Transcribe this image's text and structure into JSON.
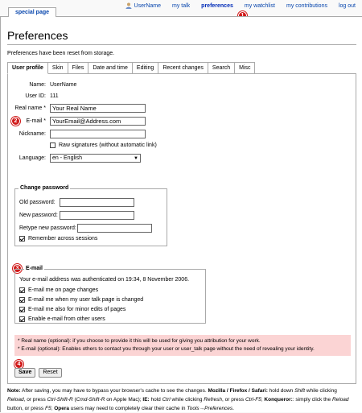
{
  "personal_bar": {
    "username": "UserName",
    "items": [
      "my talk",
      "preferences",
      "my watchlist",
      "my contributions",
      "log out"
    ],
    "active": "preferences"
  },
  "markers": [
    "1",
    "2",
    "3",
    "4"
  ],
  "special_tab": "special page",
  "title": "Preferences",
  "reset_message": "Preferences have been reset from storage.",
  "tabs": [
    "User profile",
    "Skin",
    "Files",
    "Date and time",
    "Editing",
    "Recent changes",
    "Search",
    "Misc"
  ],
  "profile": {
    "name_label": "Name:",
    "name_value": "UserName",
    "userid_label": "User ID:",
    "userid_value": "111",
    "realname_label": "Real name *",
    "realname_value": "Your Real Name",
    "email_label": "E-mail *",
    "email_value": "YourEmail@Address.com",
    "nickname_label": "Nickname:",
    "nickname_value": "",
    "raw_sig_label": "Raw signatures (without automatic link)",
    "language_label": "Language:",
    "language_value": "en - English"
  },
  "password": {
    "legend": "Change password",
    "old_label": "Old password:",
    "new_label": "New password:",
    "retype_label": "Retype new password:",
    "remember_label": "Remember across sessions"
  },
  "email": {
    "legend": "E-mail",
    "auth_text": "Your e-mail address was authenticated on 19:34, 8 November 2006.",
    "options": [
      "E-mail me on page changes",
      "E-mail me when my user talk page is changed",
      "E-mail me also for minor edits of pages",
      "Enable e-mail from other users"
    ]
  },
  "notes": {
    "realname": "* Real name (optional): if you choose to provide it this will be used for giving you attribution for your work.",
    "email": "* E-mail (optional): Enables others to contact you through your user or user_talk page without the need of revealing your identity."
  },
  "buttons": {
    "save": "Save",
    "reset": "Reset"
  },
  "footnote": {
    "bold1": "Note:",
    "text1": " After saving, you may have to bypass your browser's cache to see the changes. ",
    "bold2": "Mozilla / Firefox / Safari:",
    "text2": " hold down ",
    "it1": "Shift",
    "text3": " while clicking ",
    "it2": "Reload",
    "text4": ", or press ",
    "it3": "Ctrl-Shift-R",
    "text5": " (",
    "it4": "Cmd-Shift-R",
    "text6": " on Apple Mac); ",
    "bold3": "IE:",
    "text7": " hold ",
    "it5": "Ctrl",
    "text8": " while clicking ",
    "it6": "Refresh",
    "text9": ", or press ",
    "it7": "Ctrl-F5",
    "text10": "; ",
    "bold4": "Konqueror:",
    "text11": ": simply click the ",
    "it8": "Reload",
    "text12": " button, or press ",
    "it9": "F5",
    "text13": "; ",
    "bold5": "Opera",
    "text14": " users may need to completely clear their cache in ",
    "it10": "Tools→Preferences",
    "text15": "."
  }
}
